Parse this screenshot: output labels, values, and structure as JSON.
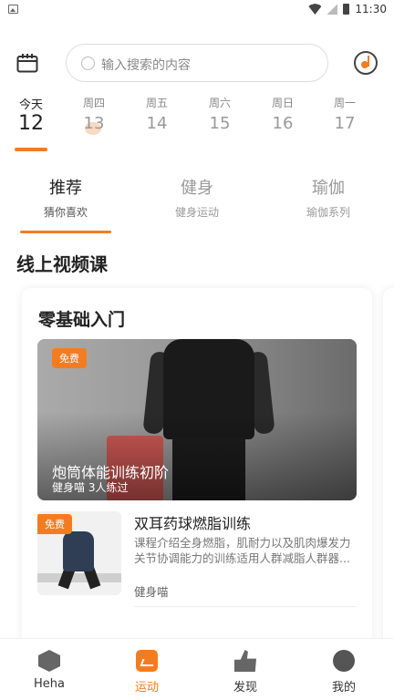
{
  "status_bar": {
    "time": "11:30"
  },
  "search": {
    "placeholder": "输入搜索的内容"
  },
  "week": [
    {
      "name": "今天",
      "date": "12",
      "selected": true
    },
    {
      "name": "周四",
      "date": "13"
    },
    {
      "name": "周五",
      "date": "14"
    },
    {
      "name": "周六",
      "date": "15"
    },
    {
      "name": "周日",
      "date": "16"
    },
    {
      "name": "周一",
      "date": "17"
    }
  ],
  "tabs": [
    {
      "label": "推荐",
      "sub": "猜你喜欢",
      "active": true
    },
    {
      "label": "健身",
      "sub": "健身运动"
    },
    {
      "label": "瑜伽",
      "sub": "瑜伽系列"
    }
  ],
  "section_title": "线上视频课",
  "card": {
    "title": "零基础入门",
    "featured": {
      "badge": "免费",
      "title": "炮筒体能训练初阶",
      "meta": "健身喵  3人练过"
    },
    "item": {
      "badge": "免费",
      "title": "双耳药球燃脂训练",
      "desc": "课程介绍全身燃脂，肌耐力以及肌肉爆发力关节协调能力的训练适用人群减脂人群器...",
      "author": "健身喵"
    }
  },
  "nav": [
    {
      "label": "Heha",
      "icon": "hexagon-icon"
    },
    {
      "label": "运动",
      "icon": "clipboard-check-icon",
      "active": true
    },
    {
      "label": "发现",
      "icon": "thumbs-up-icon"
    },
    {
      "label": "我的",
      "icon": "profile-ball-icon"
    }
  ],
  "colors": {
    "accent": "#f47c20"
  }
}
